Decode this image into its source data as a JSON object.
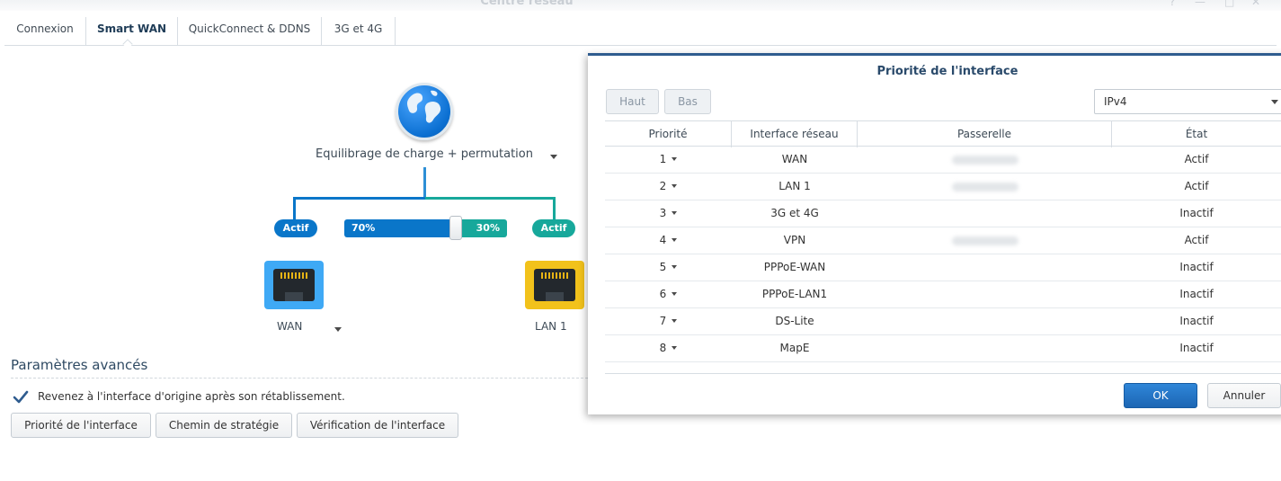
{
  "window": {
    "title": "Centre réseau"
  },
  "tabs": [
    {
      "label": "Connexion"
    },
    {
      "label": "Smart WAN"
    },
    {
      "label": "QuickConnect & DDNS"
    },
    {
      "label": "3G et 4G"
    }
  ],
  "smart_wan": {
    "mode_label": "Equilibrage de charge + permutation",
    "left_status": "Actif",
    "right_status": "Actif",
    "left_percent_label": "70%",
    "right_percent_label": "30%",
    "balance_left_fraction": 0.7,
    "left_port_label": "WAN",
    "right_port_label": "LAN 1",
    "colors": {
      "left_accent": "#0a76c9",
      "right_accent": "#17a89b",
      "left_port": "#3fa9f5",
      "right_port": "#f2c21b"
    }
  },
  "advanced": {
    "title": "Paramètres avancés",
    "checkbox_label": "Revenez à l'interface d'origine après son rétablissement.",
    "checkbox_checked": true,
    "buttons": [
      {
        "label": "Priorité de l'interface"
      },
      {
        "label": "Chemin de stratégie"
      },
      {
        "label": "Vérification de l'interface"
      }
    ]
  },
  "dialog": {
    "title": "Priorité de l'interface",
    "up_label": "Haut",
    "down_label": "Bas",
    "ip_version": "IPv4",
    "columns": [
      "Priorité",
      "Interface réseau",
      "Passerelle",
      "État"
    ],
    "rows": [
      {
        "priority": "1",
        "interface": "WAN",
        "gateway_blurred": true,
        "state": "Actif"
      },
      {
        "priority": "2",
        "interface": "LAN 1",
        "gateway_blurred": true,
        "state": "Actif"
      },
      {
        "priority": "3",
        "interface": "3G et 4G",
        "gateway_blurred": false,
        "state": "Inactif"
      },
      {
        "priority": "4",
        "interface": "VPN",
        "gateway_blurred": true,
        "state": "Actif"
      },
      {
        "priority": "5",
        "interface": "PPPoE-WAN",
        "gateway_blurred": false,
        "state": "Inactif"
      },
      {
        "priority": "6",
        "interface": "PPPoE-LAN1",
        "gateway_blurred": false,
        "state": "Inactif"
      },
      {
        "priority": "7",
        "interface": "DS-Lite",
        "gateway_blurred": false,
        "state": "Inactif"
      },
      {
        "priority": "8",
        "interface": "MapE",
        "gateway_blurred": false,
        "state": "Inactif"
      }
    ],
    "ok_label": "OK",
    "cancel_label": "Annuler"
  }
}
